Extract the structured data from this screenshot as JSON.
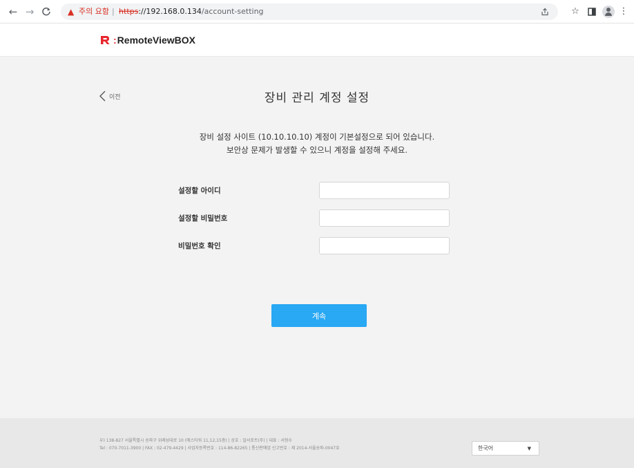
{
  "browser": {
    "warning_text": "주의 요함",
    "separator": "|",
    "url_scheme": "https",
    "url_host": "://192.168.0.134",
    "url_path": "/account-setting",
    "icons": [
      "back-icon",
      "forward-icon",
      "reload-icon",
      "not-secure-icon",
      "share-icon",
      "bookmark-star-icon",
      "side-panel-icon",
      "profile-icon",
      "menu-icon"
    ]
  },
  "header": {
    "logo_colon": ":",
    "logo_text": "RemoteViewBOX",
    "brand_color": "#e8262d"
  },
  "page": {
    "back_label": "이전",
    "title": "장비 관리 계정 설정",
    "notice_line1": "장비 설정 사이트 (10.10.10.10) 계정이 기본설정으로 되어 있습니다.",
    "notice_line2": "보안상 문제가 발생할 수 있으니 계정을 설정해 주세요."
  },
  "form": {
    "fields": [
      {
        "label": "설정할 아이디",
        "value": "",
        "placeholder": ""
      },
      {
        "label": "설정할 비밀번호",
        "value": "",
        "placeholder": ""
      },
      {
        "label": "비밀번호 확인",
        "value": "",
        "placeholder": ""
      }
    ],
    "submit_label": "계속",
    "submit_color": "#29a8f3"
  },
  "footer": {
    "line1": "우) 138-827 서울특별시 송파구 위례성대로 10 (에스타워 11,12,15층) | 상호 : 알서포트(주) | 대표 : 서형수",
    "line2": "Tel : 070-7011-3900 | FAX : 02-479-4429 | 사업자등록번호 : 114-86-82265 | 통신판매업 신고번호 : 제 2014-서울송파-0047호",
    "language": "한국어",
    "caret": "▼"
  }
}
